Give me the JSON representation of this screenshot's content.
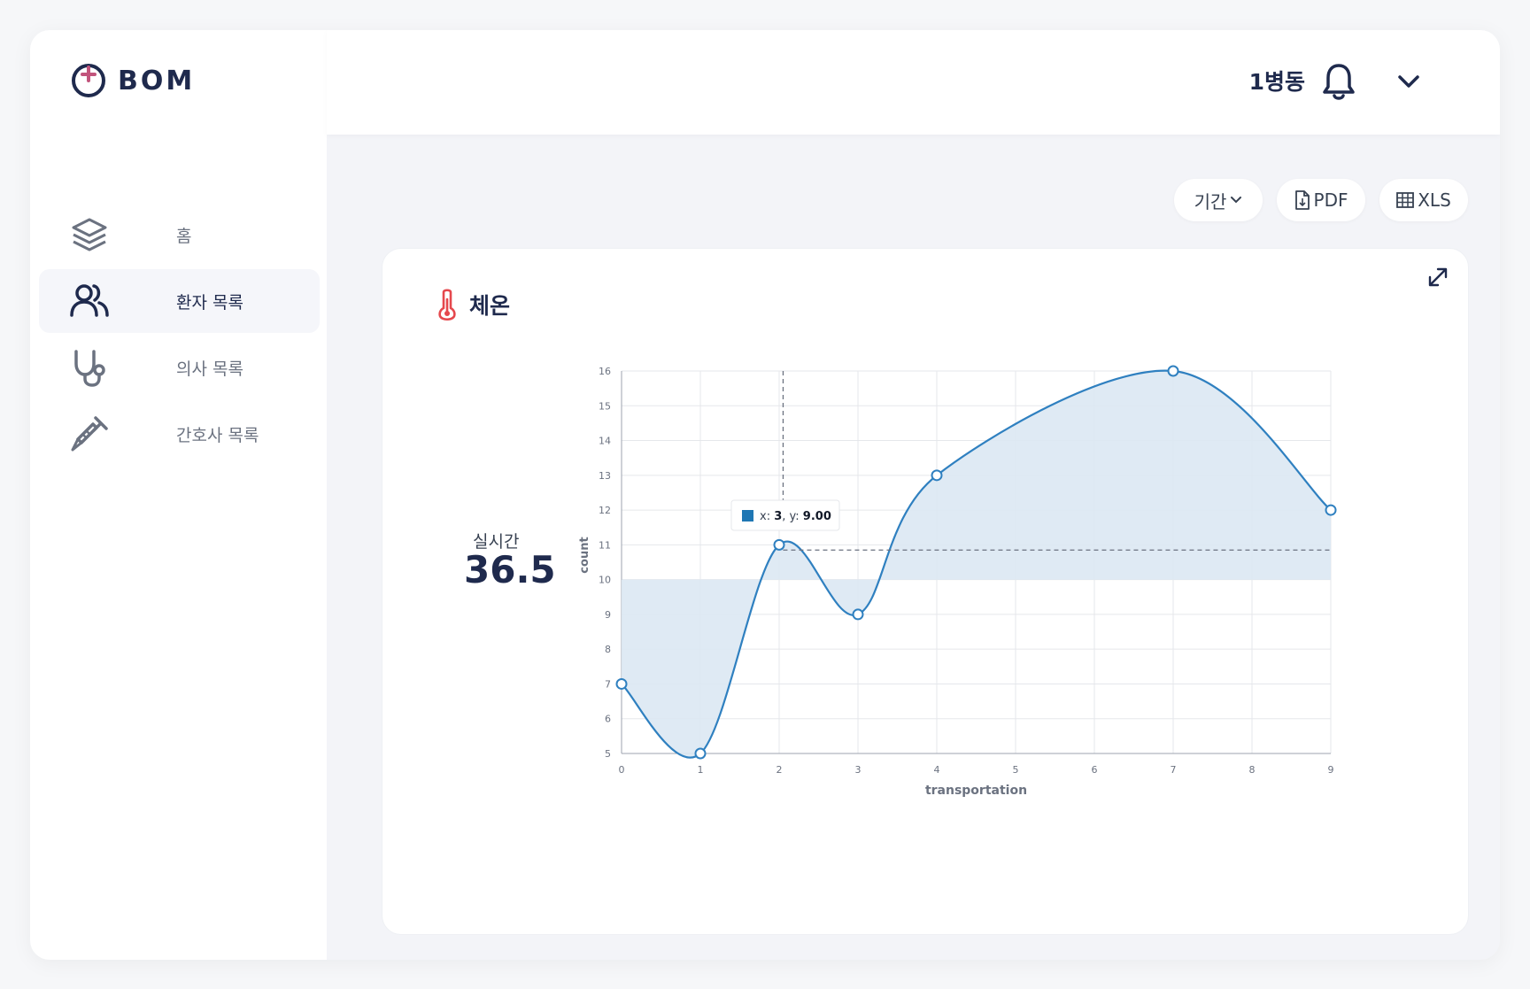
{
  "app": {
    "logo_text": "BOM"
  },
  "sidebar": {
    "items": [
      {
        "label": "홈",
        "icon": "layers-icon",
        "active": false
      },
      {
        "label": "환자 목록",
        "icon": "users-icon",
        "active": true
      },
      {
        "label": "의사 목록",
        "icon": "stethoscope-icon",
        "active": false
      },
      {
        "label": "간호사 목록",
        "icon": "syringe-icon",
        "active": false
      }
    ]
  },
  "header": {
    "ward": "1병동"
  },
  "toolbar": {
    "period": "기간",
    "pdf": "PDF",
    "xls": "XLS"
  },
  "card": {
    "title": "체온",
    "realtime_label": "실시간",
    "realtime_value": "36.5"
  },
  "colors": {
    "navy": "#1f2a4d",
    "line": "#2f80c0",
    "fill": "#dbe8f3",
    "thermo": "#e5484d"
  },
  "chart_data": {
    "type": "area",
    "x": [
      0,
      1,
      2,
      3,
      4,
      5,
      6,
      7,
      8,
      9
    ],
    "points": [
      {
        "x": 0,
        "y": 7
      },
      {
        "x": 1,
        "y": 5
      },
      {
        "x": 2,
        "y": 11
      },
      {
        "x": 3,
        "y": 9
      },
      {
        "x": 4,
        "y": 13
      },
      {
        "x": 7,
        "y": 16
      },
      {
        "x": 9,
        "y": 12
      }
    ],
    "baseline": 10,
    "xlabel": "transportation",
    "ylabel": "count",
    "xlim": [
      0,
      9
    ],
    "ylim": [
      5,
      16
    ],
    "xticks": [
      "0",
      "1",
      "2",
      "3",
      "4",
      "5",
      "6",
      "7",
      "8",
      "9"
    ],
    "yticks": [
      "5",
      "6",
      "7",
      "8",
      "9",
      "10",
      "11",
      "12",
      "13",
      "14",
      "15",
      "16"
    ],
    "grid": true,
    "tooltip": {
      "x_label": "x: ",
      "x_value": "3",
      "y_label": ", y: ",
      "y_value": "9.00"
    },
    "crosshair": {
      "x": 2.05,
      "y": 10.85
    }
  }
}
